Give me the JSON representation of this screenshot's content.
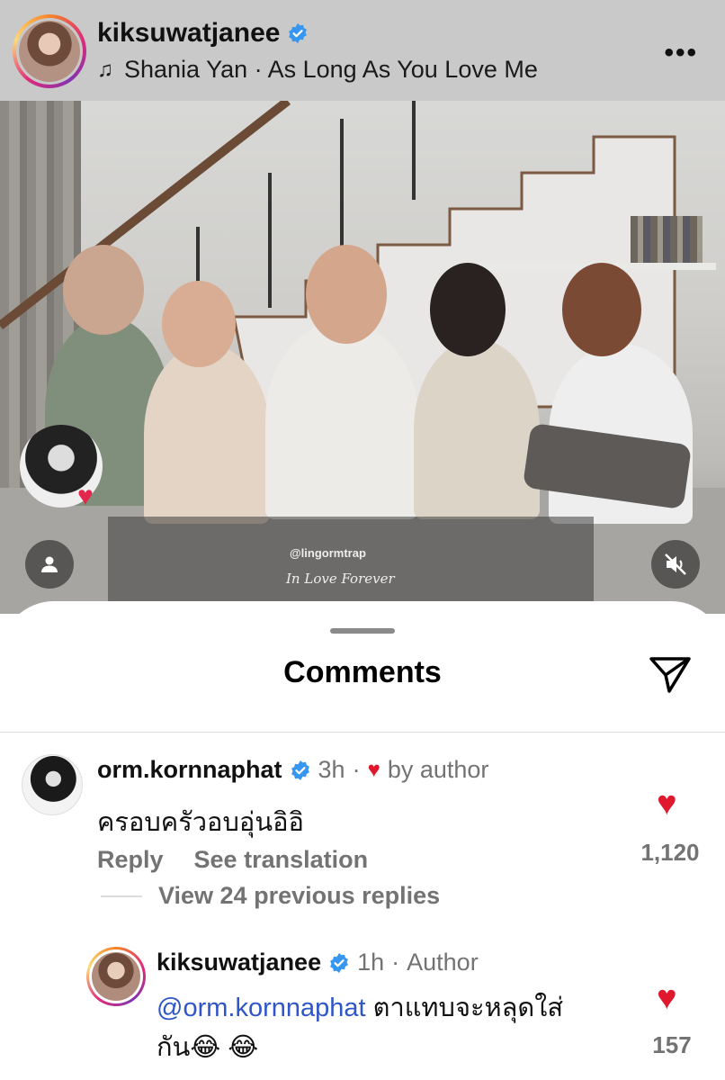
{
  "header": {
    "username": "kiksuwatjanee",
    "song_icon": "music-note-icon",
    "song": "Shania Yan · As Long As You Love Me",
    "more_icon": "more-options-icon"
  },
  "photo": {
    "watermark": "@lingormtrap",
    "watermark_caption": "In Love Forever",
    "user_icon": "user-icon",
    "mute_icon": "speaker-muted-icon"
  },
  "sheet": {
    "title": "Comments",
    "share_icon": "send-icon"
  },
  "comments": [
    {
      "username": "orm.kornnaphat",
      "time": "3h",
      "separator": "·",
      "liked_by": "by author",
      "text": "ครอบครัวอบอุ่นอิอิ",
      "reply_label": "Reply",
      "translate_label": "See translation",
      "likes": "1,120",
      "view_replies": "View 24 previous replies"
    },
    {
      "username": "kiksuwatjanee",
      "time": "1h",
      "separator": "·",
      "role": "Author",
      "mention": "@orm.kornnaphat",
      "text_line1": " ตาแทบจะหลุดใส่",
      "text_line2": "กัน😂 😂",
      "likes": "157"
    }
  ],
  "colors": {
    "heart": "#e0182d",
    "mention": "#2f56c9",
    "verified": "#3797f0",
    "secondary_text": "#737373"
  }
}
